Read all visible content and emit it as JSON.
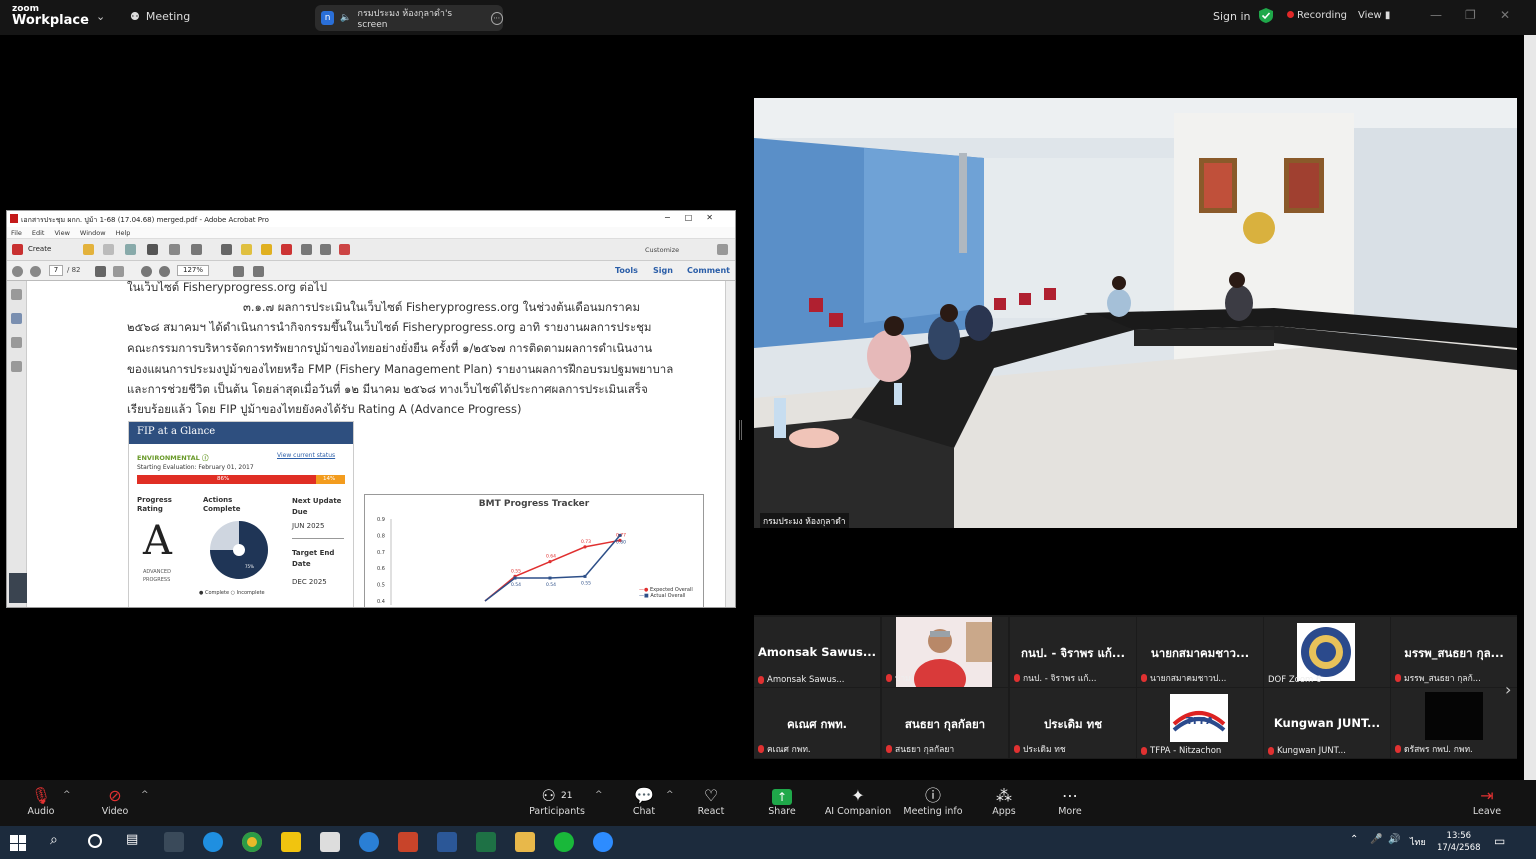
{
  "topbar": {
    "logo_small": "zoom",
    "logo_big": "Workplace",
    "meeting_label": "Meeting",
    "share_initial": "n",
    "share_label": "กรมประมง ห้องกุลาดำ's screen",
    "signin": "Sign in",
    "recording": "Recording",
    "view": "View"
  },
  "acrobat": {
    "title": "เอกสารประชุม ผกก. ปูม้า 1-68 (17.04.68) merged.pdf - Adobe Acrobat Pro",
    "menu": [
      "File",
      "Edit",
      "View",
      "Window",
      "Help"
    ],
    "create": "Create",
    "customize": "Customize",
    "page_current": "7",
    "page_total": "/ 82",
    "zoom": "127%",
    "tools": "Tools",
    "sign": "Sign",
    "comment": "Comment",
    "doc_lines": [
      "ในเว็บไซต์ Fisheryprogress.org ต่อไป",
      "๓.๑.๗ ผลการประเมินในเว็บไซต์ Fisheryprogress.org ในช่วงต้นเดือนมกราคม",
      "๒๕๖๘ สมาคมฯ ได้ดำเนินการนำกิจกรรมขึ้นในเว็บไซต์ Fisheryprogress.org อาทิ รายงานผลการประชุม",
      "คณะกรรมการบริหารจัดการทรัพยากรปูม้าของไทยอย่างยั่งยืน ครั้งที่ ๑/๒๕๖๗ การติดตามผลการดำเนินงาน",
      "ของแผนการประมงปูม้าของไทยหรือ FMP (Fishery Management Plan) รายงานผลการฝึกอบรมปฐมพยาบาล",
      "และการช่วยชีวิต เป็นต้น โดยล่าสุดเมื่อวันที่ ๑๒ มีนาคม ๒๕๖๘ ทางเว็บไซต์ได้ประกาศผลการประเมินเสร็จ",
      "เรียบร้อยแล้ว โดย FIP ปูม้าของไทยยังคงได้รับ Rating A (Advance Progress)"
    ],
    "fip": {
      "head": "FIP at a Glance",
      "env": "ENVIRONMENTAL",
      "view_status": "View current status",
      "start_eval": "Starting Evaluation: February 01, 2017",
      "bar_left": "86%",
      "bar_right": "14%",
      "bar_fraction": 0.86,
      "progress_rating": "Progress Rating",
      "rating": "A",
      "rating_sub": "ADVANCED PROGRESS",
      "actions_complete": "Actions Complete",
      "pie_complete": "75%",
      "pie_fraction": 0.75,
      "next_update": "Next Update Due",
      "next_update_val": "JUN 2025",
      "target_end": "Target End Date",
      "target_end_val": "DEC 2025",
      "legend_complete": "Complete",
      "legend_incomplete": "Incomplete"
    },
    "bmt": {
      "title": "BMT Progress Tracker",
      "yticks": [
        "0.9",
        "0.8",
        "0.7",
        "0.6",
        "0.5",
        "0.4"
      ],
      "expected_label": "Expected Overall",
      "actual_label": "Actual Overall",
      "expected_color": "#e03030",
      "actual_color": "#2d4f88"
    }
  },
  "chart_data": {
    "type": "line",
    "title": "BMT Progress Tracker",
    "ylim": [
      0.4,
      0.9
    ],
    "series": [
      {
        "name": "Expected Overall",
        "values": [
          0.4,
          0.55,
          0.64,
          0.73,
          0.77
        ]
      },
      {
        "name": "Actual Overall",
        "values": [
          0.4,
          0.54,
          0.54,
          0.55,
          0.8
        ]
      }
    ]
  },
  "video": {
    "label": "กรมประมง ห้องกุลาดำ"
  },
  "gallery": {
    "tiles": [
      {
        "name": "Amonsak Sawus...",
        "label": "Amonsak Sawus..."
      },
      {
        "name": "",
        "label": "ป่าม"
      },
      {
        "name": "กนป. - จิราพร แก้...",
        "label": "กนป. - จิราพร แก้..."
      },
      {
        "name": "นายกสมาคมชาว...",
        "label": "นายกสมาคมชาวป..."
      },
      {
        "name": "",
        "label": "DOF Zoom 6"
      },
      {
        "name": "มรรพ_สนธยา กุล...",
        "label": "มรรพ_สนธยา กุลก้..."
      },
      {
        "name": "คเณศ กพท.",
        "label": "คเณศ กพท."
      },
      {
        "name": "สนธยา กุลกัลยา",
        "label": "สนธยา กุลกัลยา"
      },
      {
        "name": "ประเดิม ทช",
        "label": "ประเดิม ทช"
      },
      {
        "name": "",
        "label": "TFPA - Nitzachon"
      },
      {
        "name": "Kungwan JUNT...",
        "label": "Kungwan JUNT..."
      },
      {
        "name": "",
        "label": "ดรัสพร กพป. กพท."
      }
    ]
  },
  "toolbar": {
    "audio": "Audio",
    "video": "Video",
    "participants": "Participants",
    "participants_count": "21",
    "chat": "Chat",
    "react": "React",
    "share": "Share",
    "ai": "AI Companion",
    "info": "Meeting info",
    "apps": "Apps",
    "more": "More",
    "leave": "Leave"
  },
  "taskbar": {
    "lang": "ไทย",
    "time": "13:56",
    "date": "17/4/2568"
  }
}
